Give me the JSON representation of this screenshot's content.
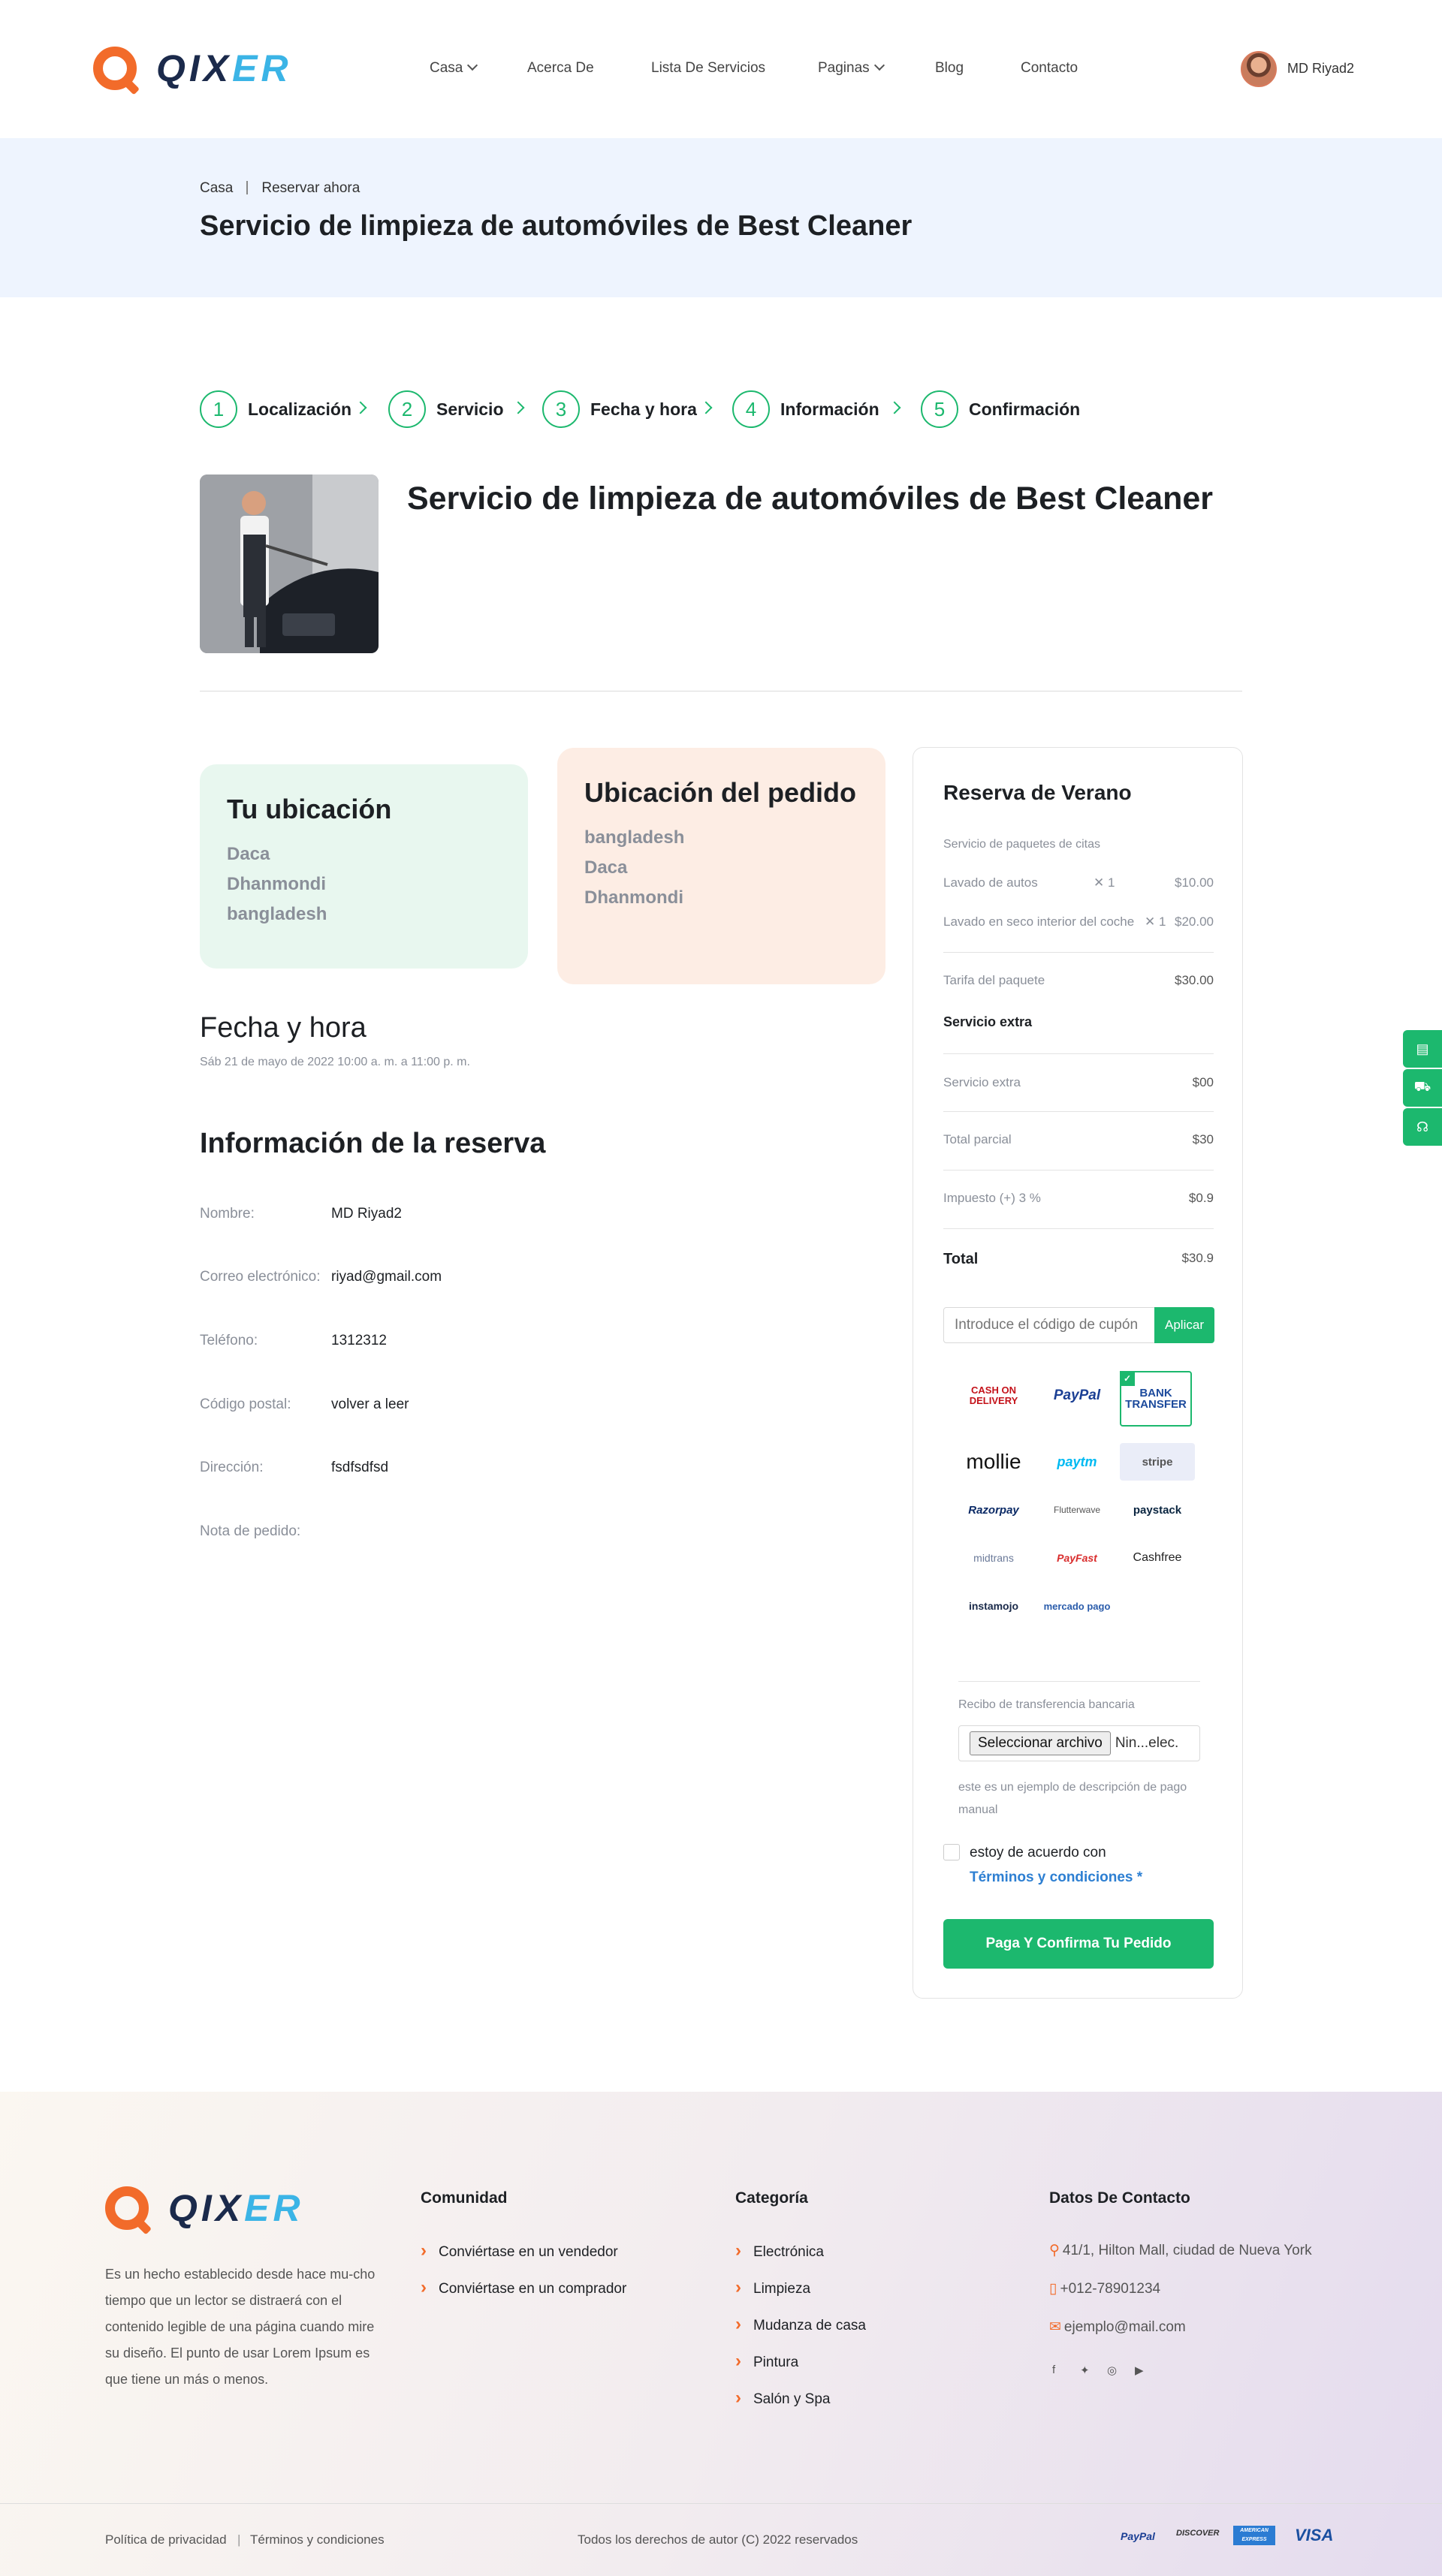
{
  "header": {
    "logo": {
      "q": "QIX",
      "er": "ER"
    },
    "nav": [
      {
        "label": "Casa",
        "dropdown": true
      },
      {
        "label": "Acerca De",
        "dropdown": false
      },
      {
        "label": "Lista De Servicios",
        "dropdown": false
      },
      {
        "label": "Paginas",
        "dropdown": true
      },
      {
        "label": "Blog",
        "dropdown": false
      },
      {
        "label": "Contacto",
        "dropdown": false
      }
    ],
    "user_name": "MD Riyad2"
  },
  "banner": {
    "breadcrumb": [
      "Casa",
      "Reservar ahora"
    ],
    "title": "Servicio de limpieza de automóviles de Best Cleaner"
  },
  "steps": [
    {
      "num": "1",
      "label": "Localización"
    },
    {
      "num": "2",
      "label": "Servicio"
    },
    {
      "num": "3",
      "label": "Fecha y hora"
    },
    {
      "num": "4",
      "label": "Información"
    },
    {
      "num": "5",
      "label": "Confirmación"
    }
  ],
  "service_title": "Servicio de limpieza de automóviles de Best Cleaner",
  "your_location": {
    "title": "Tu ubicación",
    "lines": [
      "Daca",
      "Dhanmondi",
      "bangladesh"
    ]
  },
  "order_location": {
    "title": "Ubicación del pedido",
    "lines": [
      "bangladesh",
      "Daca",
      "Dhanmondi"
    ]
  },
  "datetime": {
    "title": "Fecha y hora",
    "value": "Sáb 21 de mayo de 2022 10:00 a. m. a 11:00 p. m."
  },
  "booking_info": {
    "title": "Información de la reserva",
    "rows": [
      {
        "label": "Nombre:",
        "value": "MD Riyad2"
      },
      {
        "label": "Correo electrónico:",
        "value": "riyad@gmail.com"
      },
      {
        "label": "Teléfono:",
        "value": "1312312"
      },
      {
        "label": "Código postal:",
        "value": "volver a leer"
      },
      {
        "label": "Dirección:",
        "value": "fsdfsdfsd"
      },
      {
        "label": "Nota de pedido:",
        "value": ""
      }
    ]
  },
  "summary": {
    "title": "Reserva de Verano",
    "package_heading": "Servicio de paquetes de citas",
    "items": [
      {
        "name": "Lavado de autos",
        "qty": "1",
        "price": "$10.00"
      },
      {
        "name": "Lavado en seco interior del coche",
        "qty": "1",
        "price": "$20.00"
      }
    ],
    "package_fee_label": "Tarifa del paquete",
    "package_fee": "$30.00",
    "extra_heading": "Servicio extra",
    "extra_label": "Servicio extra",
    "extra_value": "$00",
    "subtotal_label": "Total parcial",
    "subtotal": "$30",
    "tax_label": "Impuesto (+) 3 %",
    "tax": "$0.9",
    "total_label": "Total",
    "total": "$30.9",
    "coupon_placeholder": "Introduce el código de cupón",
    "apply_label": "Aplicar",
    "payments": [
      "CASH ON DELIVERY",
      "PayPal",
      "BANK TRANSFER",
      "mollie",
      "paytm",
      "stripe",
      "Razorpay",
      "Flutterwave",
      "paystack",
      "midtrans",
      "PayFast",
      "Cashfree",
      "instamojo",
      "mercado pago"
    ],
    "receipt_label": "Recibo de transferencia bancaria",
    "file_button": "Seleccionar archivo",
    "file_status": "Nin...elec.",
    "manual_desc": "este es un ejemplo de descripción de pago manual",
    "agree_label": "estoy de acuerdo con",
    "terms_link": "Términos y condiciones *",
    "confirm_label": "Paga Y Confirma Tu Pedido"
  },
  "footer": {
    "description": "Es un hecho establecido desde hace mu-cho tiempo que un lector se distraerá con el contenido legible de una página cuando mire su diseño. El punto de usar Lorem Ipsum es que tiene un más o menos.",
    "community": {
      "title": "Comunidad",
      "links": [
        "Conviértase en un vendedor",
        "Conviértase en un comprador"
      ]
    },
    "category": {
      "title": "Categoría",
      "links": [
        "Electrónica",
        "Limpieza",
        "Mudanza de casa",
        "Pintura",
        "Salón y Spa"
      ]
    },
    "contact": {
      "title": "Datos De Contacto",
      "address": "41/1, Hilton Mall, ciudad de Nueva York",
      "phone": "+012-78901234",
      "email": "ejemplo@mail.com"
    },
    "privacy": "Política de privacidad",
    "terms": "Términos y condiciones",
    "copyright": "Todos los derechos de autor (C) 2022 reservados",
    "cards": [
      "PayPal",
      "DISCOVER",
      "AMERICAN EXPRESS",
      "VISA"
    ]
  },
  "colors": {
    "primary": "#1cb86e",
    "accent": "#f26b2a",
    "banner": "#eef4fe",
    "location_card": "#e8f7ef",
    "order_card": "#fdede4"
  }
}
